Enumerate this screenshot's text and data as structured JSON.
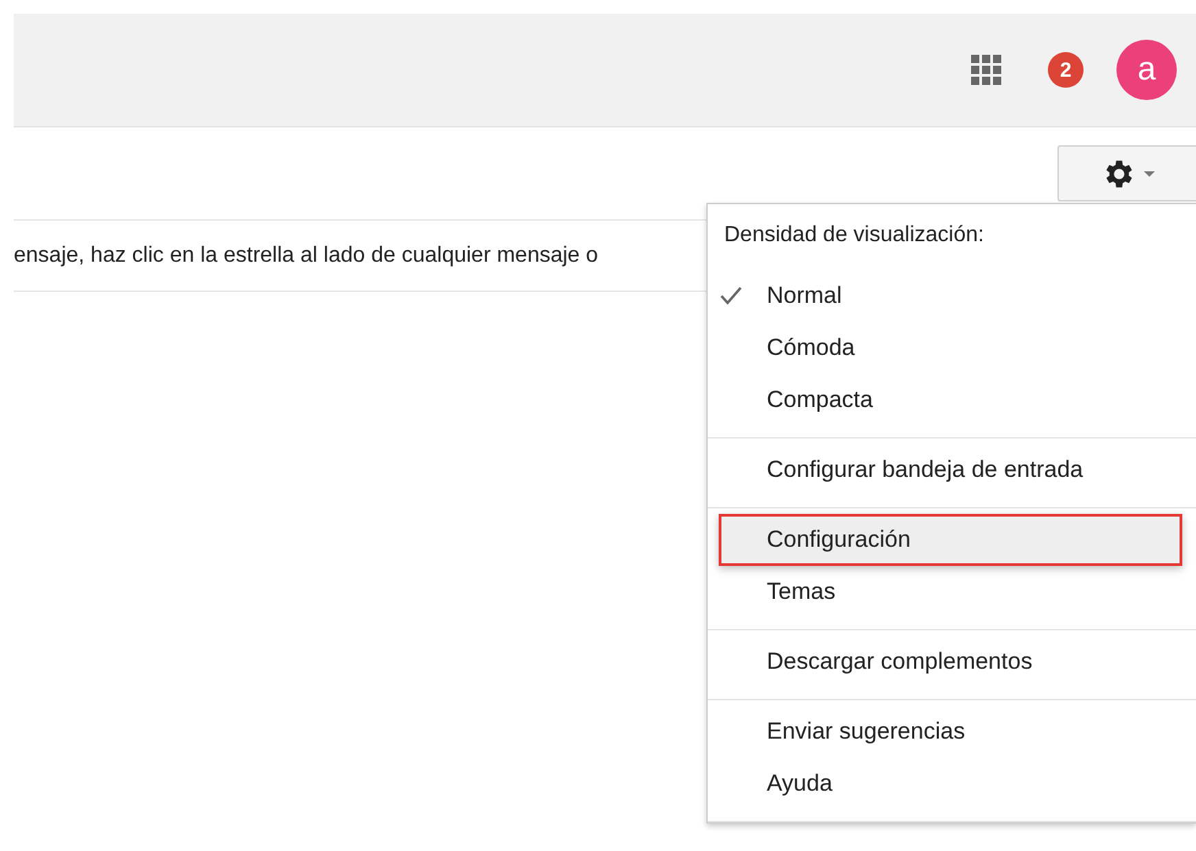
{
  "header": {
    "notification_count": "2",
    "avatar_letter": "a"
  },
  "message_text": "ensaje, haz clic en la estrella al lado de cualquier mensaje o",
  "settings_menu": {
    "heading": "Densidad de visualización:",
    "sections": [
      [
        {
          "label": "Normal",
          "checked": true,
          "selected": false,
          "annotated": false
        },
        {
          "label": "Cómoda",
          "checked": false,
          "selected": false,
          "annotated": false
        },
        {
          "label": "Compacta",
          "checked": false,
          "selected": false,
          "annotated": false
        }
      ],
      [
        {
          "label": "Configurar bandeja de entrada",
          "checked": false,
          "selected": false,
          "annotated": false
        }
      ],
      [
        {
          "label": "Configuración",
          "checked": false,
          "selected": true,
          "annotated": true
        },
        {
          "label": "Temas",
          "checked": false,
          "selected": false,
          "annotated": false
        }
      ],
      [
        {
          "label": "Descargar complementos",
          "checked": false,
          "selected": false,
          "annotated": false
        }
      ],
      [
        {
          "label": "Enviar sugerencias",
          "checked": false,
          "selected": false,
          "annotated": false
        },
        {
          "label": "Ayuda",
          "checked": false,
          "selected": false,
          "annotated": false
        }
      ]
    ]
  }
}
